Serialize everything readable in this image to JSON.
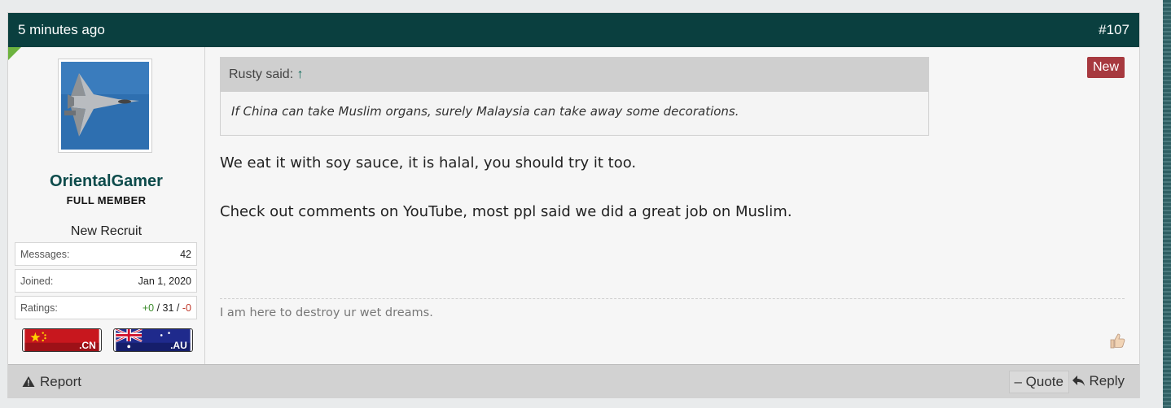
{
  "post": {
    "time": "5 minutes ago",
    "number": "#107",
    "new_badge": "New"
  },
  "user": {
    "name": "OrientalGamer",
    "title": "FULL MEMBER",
    "rank": "New Recruit",
    "stats": [
      {
        "label": "Messages:",
        "value": "42"
      },
      {
        "label": "Joined:",
        "value": "Jan 1, 2020"
      }
    ],
    "ratings": {
      "label": "Ratings:",
      "positive": "+0",
      "sep1": " / ",
      "neutral": "31",
      "sep2": " / ",
      "negative": "-0"
    },
    "flags": [
      ".CN",
      ".AU"
    ]
  },
  "quote": {
    "author": "Rusty said:",
    "arrow": "↑",
    "text": "If China can take Muslim organs, surely Malaysia can take away some decorations."
  },
  "message": {
    "line1": "We eat it with soy sauce, it is halal, you should try it too.",
    "line2": "Check out comments on YouTube, most ppl said we did a great job on Muslim."
  },
  "signature": "I am here to destroy ur wet dreams.",
  "footer": {
    "report": "Report",
    "quote": "– Quote",
    "reply": "Reply"
  },
  "colors": {
    "header_bg": "#0a3f3f",
    "username": "#0d4b4b",
    "new_badge": "#a7393f",
    "accent_green": "#6db33f"
  }
}
